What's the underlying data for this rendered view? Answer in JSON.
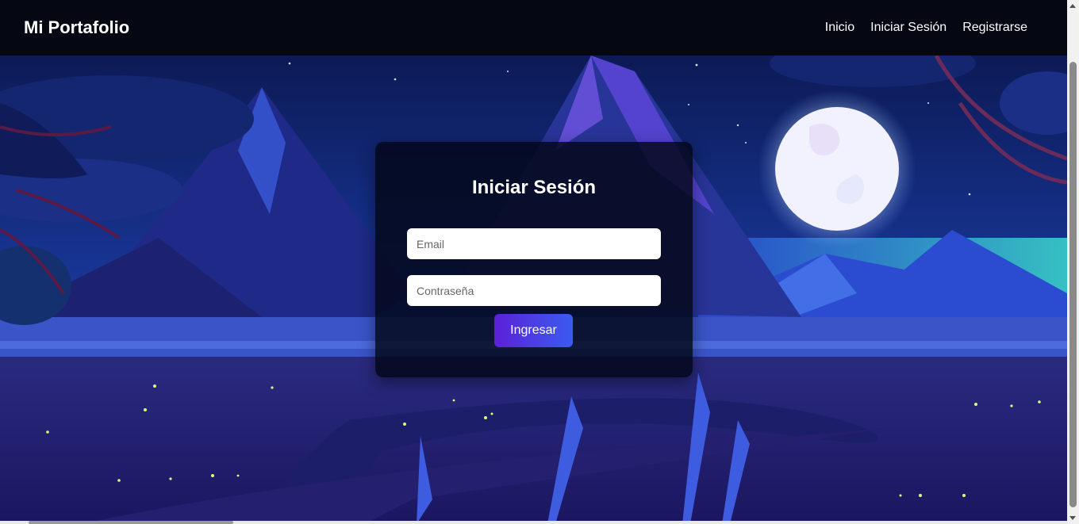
{
  "navbar": {
    "brand": "Mi Portafolio",
    "links": [
      "Inicio",
      "Iniciar Sesión",
      "Registrarse"
    ]
  },
  "login": {
    "title": "Iniciar Sesión",
    "email_placeholder": "Email",
    "password_placeholder": "Contraseña",
    "submit_label": "Ingresar"
  },
  "colors": {
    "navbar_bg": "#050813",
    "card_bg": "#020616",
    "button_gradient_start": "#5b21d8",
    "button_gradient_end": "#3b5bf0"
  }
}
